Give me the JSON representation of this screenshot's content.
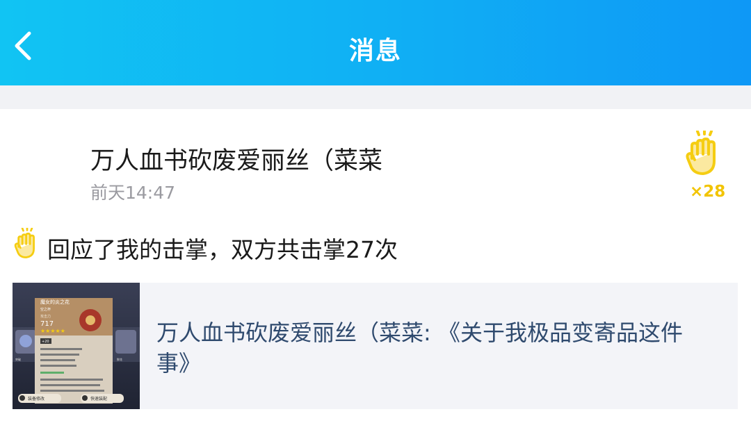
{
  "header": {
    "title": "消息"
  },
  "notification": {
    "sender_name": "万人血书砍废爱丽丝（菜菜",
    "timestamp": "前天14:47",
    "clap_count": "×28",
    "message": "回应了我的击掌，双方共击掌27次",
    "post_title": "万人血书砍废爱丽丝（菜菜: 《关于我极品变寄品这件事》",
    "thumbnail": {
      "card_title": "魔女的炎之花",
      "sub_label": "空之杯",
      "stat_label": "攻击力",
      "stat_value": "717",
      "level": "+20",
      "slot_labels": [
        "突破",
        "游戏",
        "鲜花"
      ],
      "left_button": "装备修改",
      "right_button": "快速装配"
    }
  },
  "colors": {
    "header_gradient_start": "#11c4f3",
    "header_gradient_end": "#0e98f6",
    "clap_yellow": "#f5cd12",
    "link_text": "#2f4a6e"
  },
  "icons": {
    "back": "chevron-left-icon",
    "clap_total": "high-five-icon",
    "clap_inline": "high-five-icon"
  }
}
